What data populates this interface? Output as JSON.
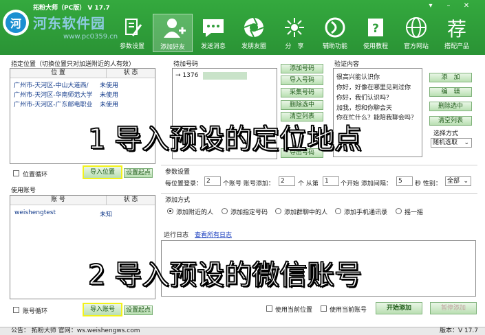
{
  "window": {
    "title": "拓粉大师（PC版） V 17.7",
    "controls": [
      "▾",
      "–",
      "✕"
    ]
  },
  "watermark": {
    "logo": "河",
    "site": "河东软件园",
    "url": "www.pc0359.cn"
  },
  "toolbar": [
    {
      "label": "参数设置",
      "icon": "settings-edit-icon"
    },
    {
      "label": "添加好友",
      "icon": "add-friend-icon",
      "active": true
    },
    {
      "label": "发送消息",
      "icon": "chat-icon"
    },
    {
      "label": "发朋友圈",
      "icon": "moments-camera-icon"
    },
    {
      "label": "分　享",
      "icon": "share-icon"
    },
    {
      "label": "辅助功能",
      "icon": "helper-icon"
    },
    {
      "label": "使用教程",
      "icon": "help-book-icon"
    },
    {
      "label": "官方网站",
      "icon": "globe-icon"
    },
    {
      "label": "搭配产品",
      "icon": "product-icon"
    }
  ],
  "location": {
    "section_label": "指定位置（切换位置只对加送附近的人有效）",
    "col_position": "位 置",
    "col_status": "状 态",
    "rows": [
      {
        "position": "广州市-天河区-中山大道西/",
        "status": "未使用"
      },
      {
        "position": "广州市-天河区-华南师范大学",
        "status": "未使用"
      },
      {
        "position": "广州市-天河区-广东邮电职业",
        "status": "未使用"
      }
    ],
    "loop_label": "位置循环",
    "import_btn": "导入位置",
    "set_start_btn": "设置起点"
  },
  "accounts": {
    "section_label": "使用账号",
    "col_account": "账 号",
    "col_status": "状 态",
    "rows": [
      {
        "account": "weishengtest",
        "status": "未知"
      }
    ],
    "loop_label": "账号循环",
    "import_btn": "导入账号",
    "set_start_btn": "设置起点"
  },
  "numbers": {
    "section_label": "待加号码",
    "rows": [
      "→  1376"
    ],
    "buttons": [
      "添加号码",
      "导入号码",
      "采集号码",
      "删除选中",
      "清空列表",
      "导出号码"
    ]
  },
  "verify": {
    "section_label": "验证内容",
    "lines": [
      "很高兴能认识你",
      "你好，好像在哪里见到过你",
      "你好，我们认识吗？",
      "加我，想和你聊会天",
      "你在忙什么？能陪我聊会吗？"
    ],
    "buttons": [
      "添　加",
      "编　辑",
      "删除选中",
      "清空列表"
    ],
    "select_label": "选择方式",
    "select_value": "随机选取"
  },
  "params": {
    "section_label": "参数设置",
    "login_label": "每位置登录：",
    "login_value": "2",
    "account_add_label": "个账号 账号添加：",
    "account_add_value": "2",
    "from_label": "个 从第",
    "from_value": "1",
    "interval_label": "个开始 添加间隔：",
    "interval_value": "5",
    "sec_label": "秒 性别：",
    "gender_value": "全部"
  },
  "method": {
    "section_label": "添加方式",
    "options": [
      {
        "label": "添加附近的人",
        "selected": true
      },
      {
        "label": "添加指定号码",
        "selected": false
      },
      {
        "label": "添加群聊中的人",
        "selected": false
      },
      {
        "label": "添加手机通讯录",
        "selected": false
      },
      {
        "label": "摇一摇",
        "selected": false
      }
    ]
  },
  "log": {
    "section_label": "运行日志",
    "view_all": "查看所有日志"
  },
  "bottom": {
    "use_current_location": "使用当前位置",
    "use_current_account": "使用当前账号",
    "start_btn": "开始添加",
    "pause_btn": "暂停添加"
  },
  "overlay": {
    "step1": "1 导入预设的定位地点",
    "step2": "2 导入预设的微信账号"
  },
  "status_bar": {
    "notice": "公告：  拓粉大师 官网：ws.weishengws.com",
    "version": "版本：V 17.7"
  },
  "colors": {
    "header": "#2f9e3a",
    "highlight": "#f2f21a",
    "link": "#1b3fbf"
  }
}
